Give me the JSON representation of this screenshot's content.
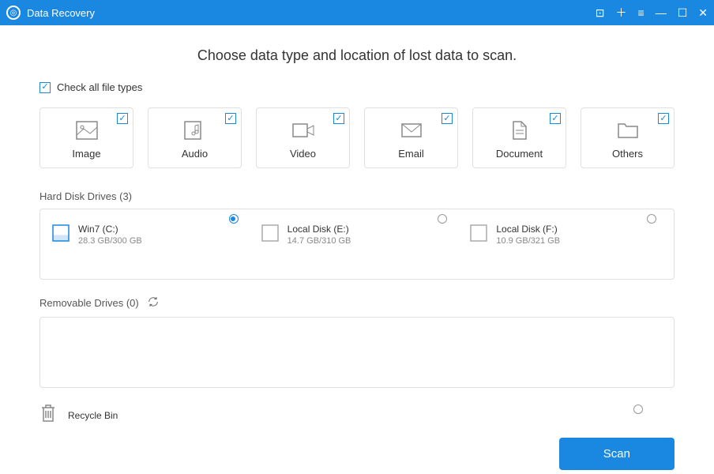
{
  "title": "Data Recovery",
  "heading": "Choose data type and location of lost data to scan.",
  "check_all_label": "Check all file types",
  "check_all_checked": true,
  "types": [
    {
      "label": "Image",
      "checked": true,
      "icon": "image"
    },
    {
      "label": "Audio",
      "checked": true,
      "icon": "audio"
    },
    {
      "label": "Video",
      "checked": true,
      "icon": "video"
    },
    {
      "label": "Email",
      "checked": true,
      "icon": "email"
    },
    {
      "label": "Document",
      "checked": true,
      "icon": "document"
    },
    {
      "label": "Others",
      "checked": true,
      "icon": "folder"
    }
  ],
  "hard_disk": {
    "label": "Hard Disk Drives (3)",
    "drives": [
      {
        "name": "Win7 (C:)",
        "size": "28.3 GB/300 GB",
        "selected": true
      },
      {
        "name": "Local Disk (E:)",
        "size": "14.7 GB/310 GB",
        "selected": false
      },
      {
        "name": "Local Disk (F:)",
        "size": "10.9 GB/321 GB",
        "selected": false
      }
    ]
  },
  "removable": {
    "label": "Removable Drives (0)"
  },
  "recycle_bin_label": "Recycle Bin",
  "scan_button": "Scan"
}
